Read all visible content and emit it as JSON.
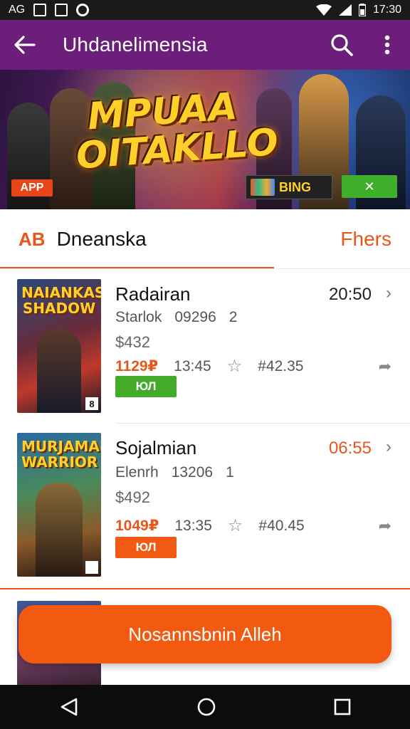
{
  "status_bar": {
    "left_text": "AG",
    "time": "17:30"
  },
  "app_bar": {
    "title": "Uhdanelimensia"
  },
  "banner": {
    "logo_line1": "MPUAA",
    "logo_line2": "OITAKLLO",
    "left_badge": "APP",
    "chip_label": "BING",
    "button_label": "✕"
  },
  "section": {
    "icon_text": "AB",
    "title": "Dneanska",
    "link": "Fhers"
  },
  "items": [
    {
      "cover_title": "NAIANKAS SHADOW",
      "cover_badge": "8",
      "name": "Radairan",
      "time": "20:50",
      "meta1": "Starlok",
      "meta2": "09296",
      "meta3": "2",
      "price": "$432",
      "stat_hl": "1129₽",
      "stat2": "13:45",
      "stat3": "#42.35",
      "tag": "ЮЛ",
      "tag_color": "#44aa2a",
      "time_color": "#222222"
    },
    {
      "cover_title": "MURJAMAR WARRIOR",
      "cover_badge": "",
      "name": "Sojalmian",
      "time": "06:55",
      "meta1": "Elenrh",
      "meta2": "13206",
      "meta3": "1",
      "price": "$492",
      "stat_hl": "1049₽",
      "stat2": "13:35",
      "stat3": "#40.45",
      "tag": "ЮЛ",
      "tag_color": "#f05a12",
      "time_color": "#e8561a"
    }
  ],
  "cta": {
    "label": "Nosannsbnin Alleh"
  },
  "colors": {
    "app_bar": "#6b1f7a",
    "accent": "#e8561a",
    "cta": "#f25a12"
  }
}
